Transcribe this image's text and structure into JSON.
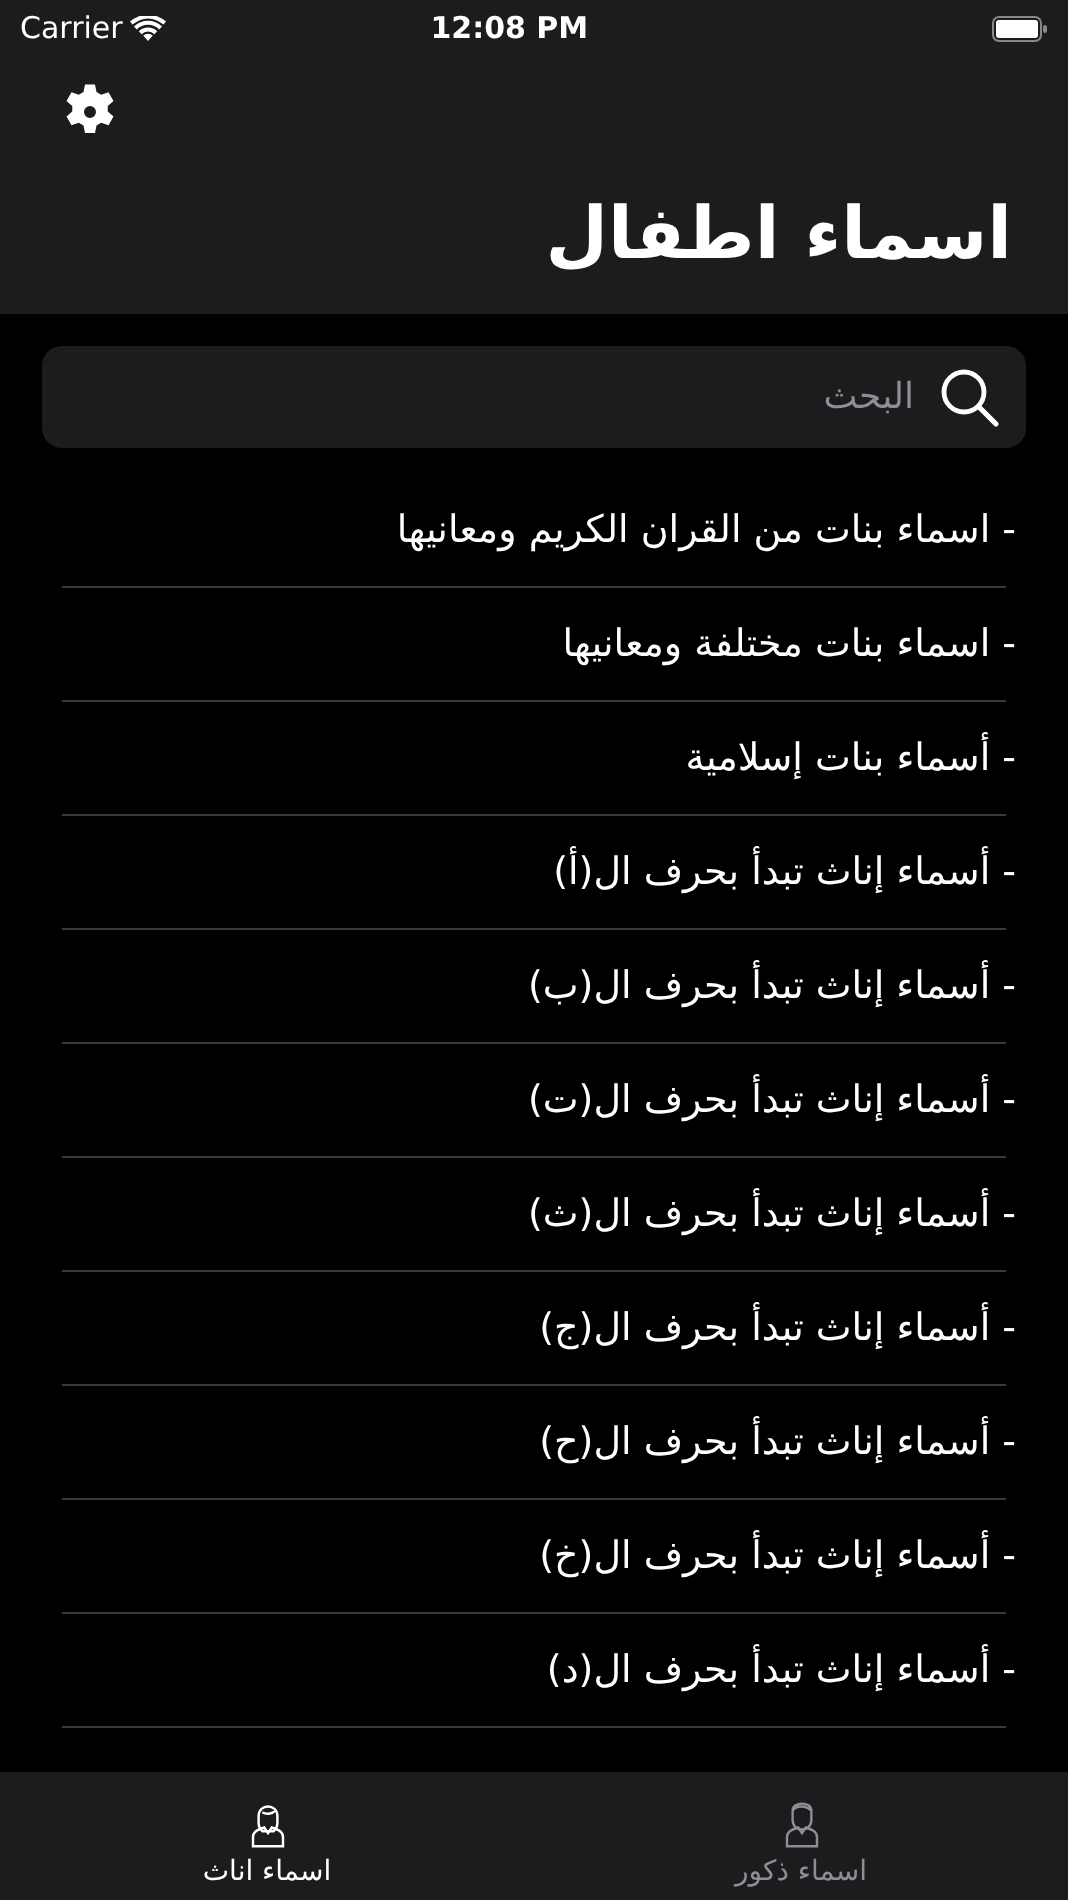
{
  "status_bar": {
    "carrier": "Carrier",
    "time": "12:08 PM"
  },
  "nav": {
    "title": "اسماء اطفال"
  },
  "search": {
    "placeholder": "البحث"
  },
  "items": [
    {
      "label": "- اسماء بنات من القران الكريم ومعانيها"
    },
    {
      "label": "- اسماء بنات مختلفة ومعانيها"
    },
    {
      "label": "- أسماء بنات إسلامية"
    },
    {
      "label": "- أسماء إناث تبدأ بحرف ال(أ)"
    },
    {
      "label": "- أسماء إناث تبدأ بحرف ال(ب)"
    },
    {
      "label": "- أسماء إناث تبدأ بحرف ال(ت)"
    },
    {
      "label": "- أسماء إناث تبدأ بحرف ال(ث)"
    },
    {
      "label": "- أسماء إناث تبدأ بحرف ال(ج)"
    },
    {
      "label": "- أسماء إناث تبدأ بحرف ال(ح)"
    },
    {
      "label": "- أسماء إناث تبدأ بحرف ال(خ)"
    },
    {
      "label": "- أسماء إناث تبدأ بحرف ال(د)"
    }
  ],
  "tabs": [
    {
      "label": "اسماء ذكور",
      "kind": "male",
      "selected": false
    },
    {
      "label": "اسماء اناث",
      "kind": "female",
      "selected": true
    }
  ]
}
